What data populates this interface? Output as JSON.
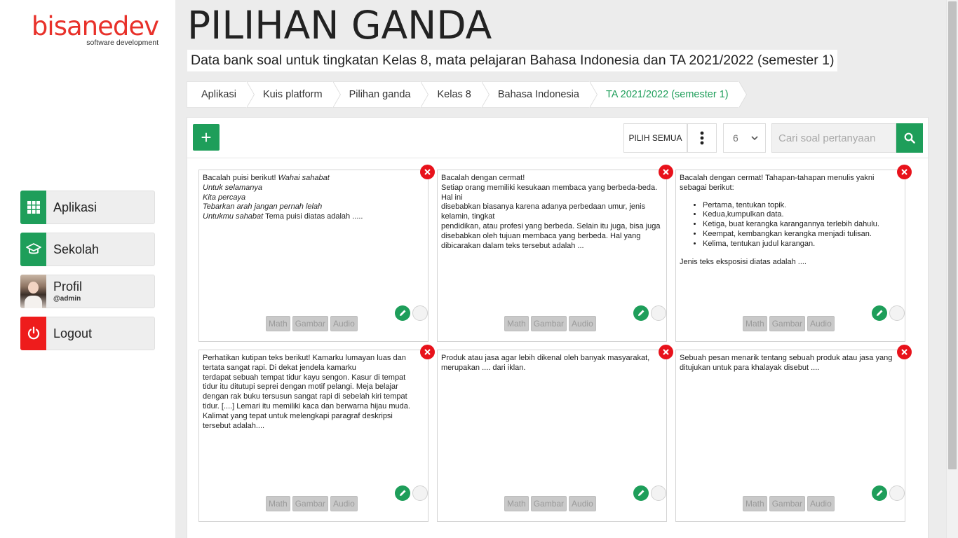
{
  "brand": {
    "name": "bisanedev",
    "tagline": "software development"
  },
  "sidebar": {
    "items": [
      {
        "label": "Aplikasi",
        "icon": "grid-icon"
      },
      {
        "label": "Sekolah",
        "icon": "graduation-cap-icon"
      },
      {
        "label": "Profil",
        "sub": "@admin",
        "icon": "avatar"
      },
      {
        "label": "Logout",
        "icon": "power-icon"
      }
    ]
  },
  "page": {
    "title": "PILIHAN GANDA",
    "subtitle": "Data bank soal untuk tingkatan Kelas 8, mata pelajaran Bahasa Indonesia dan TA 2021/2022 (semester 1)"
  },
  "breadcrumb": [
    "Aplikasi",
    "Kuis platform",
    "Pilihan ganda",
    "Kelas 8",
    "Bahasa Indonesia",
    "TA 2021/2022 (semester 1)"
  ],
  "toolbar": {
    "add_label": "+",
    "select_all_label": "PILIH SEMUA",
    "per_page": "6",
    "search_placeholder": "Cari soal pertanyaan"
  },
  "tags": {
    "math": "Math",
    "image": "Gambar",
    "audio": "Audio"
  },
  "questions": [
    {
      "p1": "Bacalah puisi berikut! ",
      "i1": "Wahai sahabat",
      "i2": "Untuk selamanya",
      "i3": "Kita percaya",
      "i4": "Tebarkan arah jangan pernah lelah",
      "i5": "Untukmu sahabat",
      "p2": " Tema puisi diatas adalah ....."
    },
    {
      "l1": "Bacalah dengan cermat!",
      "l2": "Setiap orang memiliki kesukaan membaca yang berbeda-beda. Hal ini",
      "l3": "disebabkan biasanya karena adanya perbedaan umur, jenis kelamin, tingkat",
      "l4": "pendidikan, atau profesi yang berbeda. Selain itu juga, bisa juga disebabkan oleh tujuan membaca yang berbeda. Hal yang dibicarakan dalam teks tersebut adalah ..."
    },
    {
      "intro": "Bacalah dengan cermat! Tahapan-tahapan menulis yakni sebagai berikut:",
      "steps": [
        "Pertama, tentukan topik.",
        "Kedua,kumpulkan data.",
        "Ketiga, buat kerangka karangannya terlebih dahulu.",
        "Keempat, kembangkan kerangka menjadi tulisan.",
        "Kelima, tentukan judul karangan."
      ],
      "outro": "Jenis teks eksposisi diatas adalah ...."
    },
    {
      "l1": "Perhatikan kutipan teks berikut! Kamarku lumayan luas dan tertata sangat rapi. Di dekat jendela kamarku",
      "l2": "terdapat sebuah tempat tidur kayu sengon. Kasur di tempat tidur itu ditutupi seprei dengan motif pelangi. Meja belajar dengan rak buku tersusun sangat rapi di sebelah kiri tempat tidur. [....] Lemari itu memiliki kaca dan berwarna hijau muda. Kalimat yang tepat untuk melengkapi paragraf deskripsi tersebut adalah...."
    },
    {
      "text": "Produk atau jasa agar lebih dikenal oleh banyak masyarakat, merupakan .... dari iklan."
    },
    {
      "text": "Sebuah pesan menarik tentang sebuah produk atau jasa yang ditujukan untuk para khalayak disebut ...."
    }
  ],
  "colors": {
    "accent": "#1e9e5a",
    "danger": "#e8121b",
    "brand": "#e8312a"
  }
}
